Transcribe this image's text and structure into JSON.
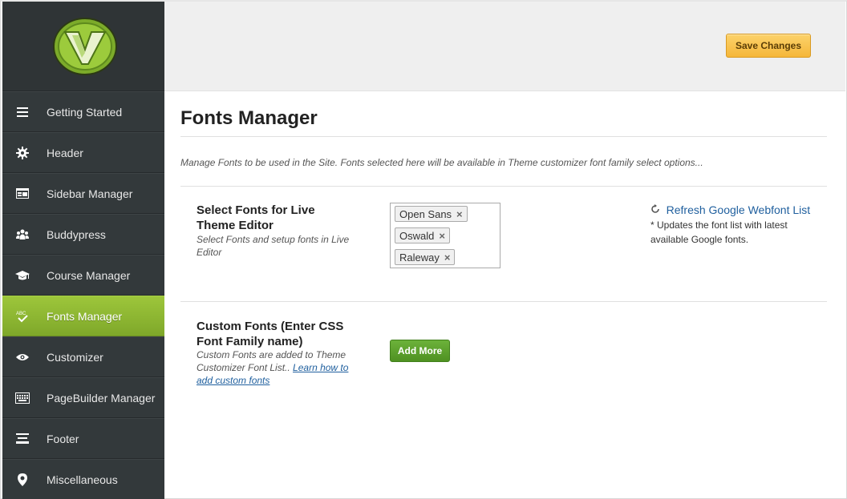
{
  "header": {
    "save_label": "Save Changes"
  },
  "sidebar": {
    "items": [
      {
        "label": "Getting Started",
        "icon": "menu-icon"
      },
      {
        "label": "Header",
        "icon": "gear-icon"
      },
      {
        "label": "Sidebar Manager",
        "icon": "sidebar-icon"
      },
      {
        "label": "Buddypress",
        "icon": "people-icon"
      },
      {
        "label": "Course Manager",
        "icon": "graduation-cap-icon"
      },
      {
        "label": "Fonts Manager",
        "icon": "spellcheck-icon",
        "active": true,
        "icon_text": "ABC"
      },
      {
        "label": "Customizer",
        "icon": "eye-icon"
      },
      {
        "label": "PageBuilder Manager",
        "icon": "keyboard-icon"
      },
      {
        "label": "Footer",
        "icon": "footer-icon"
      },
      {
        "label": "Miscellaneous",
        "icon": "location-pin-icon"
      }
    ]
  },
  "main": {
    "title": "Fonts Manager",
    "description": "Manage Fonts to be used in the Site. Fonts selected here will be available in Theme customizer font family select options...",
    "select_fonts": {
      "title": "Select Fonts for Live Theme Editor",
      "subtitle": "Select Fonts and setup fonts in Live Editor",
      "fonts": [
        "Open Sans",
        "Oswald",
        "Raleway"
      ],
      "remove_glyph": "×",
      "refresh_link": "Refresh Google Webfont List",
      "refresh_note": "* Updates the font list with latest available Google fonts."
    },
    "custom_fonts": {
      "title": "Custom Fonts (Enter CSS Font Family name)",
      "subtitle": "Custom Fonts are added to Theme Customizer Font List..",
      "learn_link": "Learn how to add custom fonts",
      "add_label": "Add More"
    }
  },
  "colors": {
    "sidebar_bg": "#33393b",
    "active_green": "#8dbb33",
    "save_yellow": "#f7c14f",
    "add_green": "#5aa02b",
    "link_blue": "#1f5f9e"
  }
}
